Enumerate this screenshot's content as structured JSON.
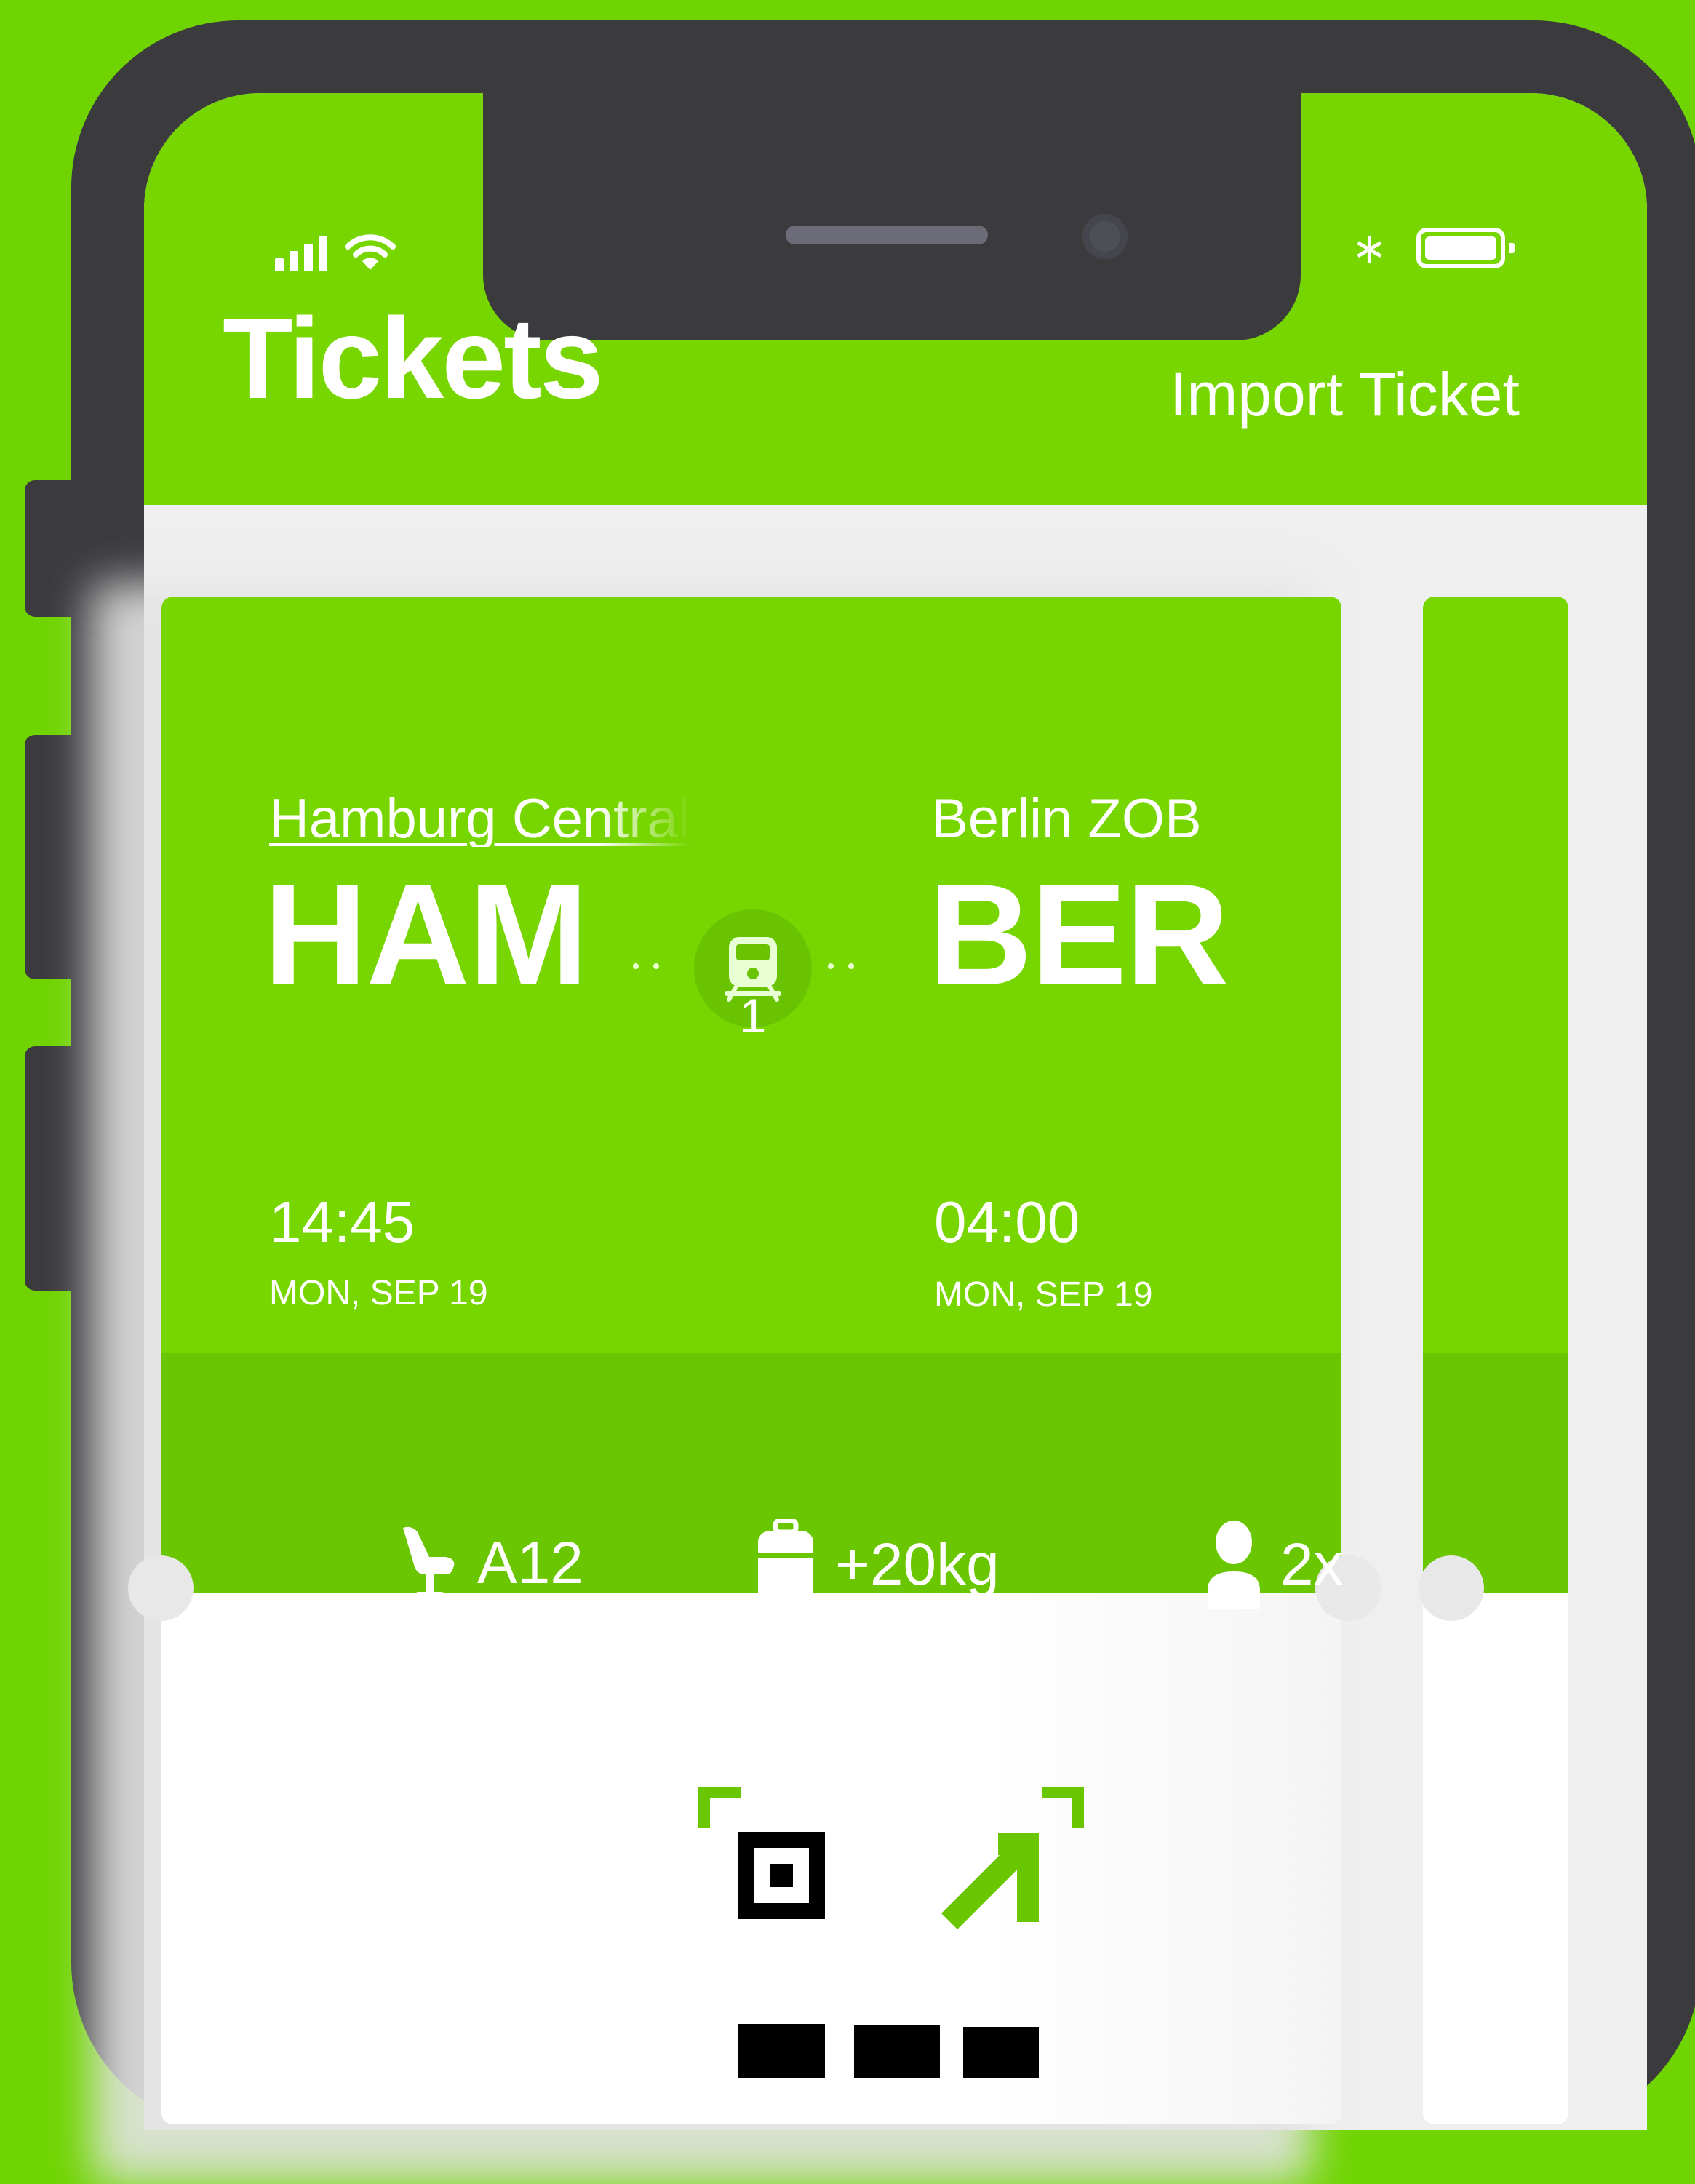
{
  "header": {
    "title": "Tickets",
    "import_label": "Import Ticket"
  },
  "status_bar": {
    "icons": [
      "signal-icon",
      "wifi-icon",
      "bluetooth-icon",
      "battery-icon"
    ],
    "bluetooth_glyph": "∗"
  },
  "ticket": {
    "from": {
      "station": "Hamburg Central",
      "code": "HAM",
      "time": "14:45",
      "date": "MON, SEP 19"
    },
    "to": {
      "station": "Berlin ZOB",
      "code": "BER",
      "time": "04:00",
      "date": "MON, SEP 19"
    },
    "transport_icon": "train-icon",
    "stops": "1",
    "seat": "A12",
    "baggage": "+20kg",
    "passengers": "2x"
  },
  "colors": {
    "brand_green": "#78d600",
    "amenity_green": "#6ac600",
    "background_green": "#6fd400",
    "device_gray": "#3b3b3e"
  }
}
